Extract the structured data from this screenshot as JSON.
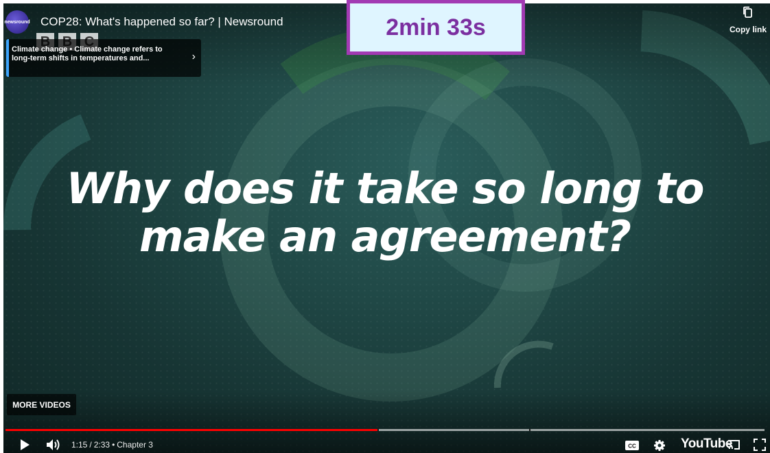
{
  "player": {
    "title": "COP28: What's happened so far? | Newsround",
    "channel_avatar_text": "newsround",
    "bbc_letters": [
      "B",
      "B",
      "C"
    ],
    "copy_link_label": "Copy link",
    "info_card_text": "Climate change • Climate change refers to long-term shifts in temperatures and...",
    "headline_line1": "Why does it take so long to",
    "headline_line2": "make an agreement?",
    "more_videos_label": "MORE VIDEOS",
    "progress": {
      "played_fraction": 0.49,
      "loaded_fraction": 1.0,
      "chapter_markers_fraction": [
        0.49,
        0.69
      ]
    },
    "controls": {
      "current_time": "1:15",
      "separator": "/",
      "duration": "2:33",
      "bullet": "•",
      "chapter": "Chapter 3",
      "youtube_label": "YouTube"
    }
  },
  "overlay": {
    "duration_badge": "2min 33s"
  },
  "colors": {
    "accent_red": "#ff0000",
    "badge_border": "#a23ab3",
    "badge_background": "#dff5ff",
    "badge_text": "#7b2fa0",
    "card_accent": "#3ea6ff"
  },
  "icons": [
    "play-icon",
    "volume-icon",
    "captions-icon",
    "settings-icon",
    "cast-icon",
    "fullscreen-icon",
    "copy-icon",
    "chevron-right-icon"
  ]
}
